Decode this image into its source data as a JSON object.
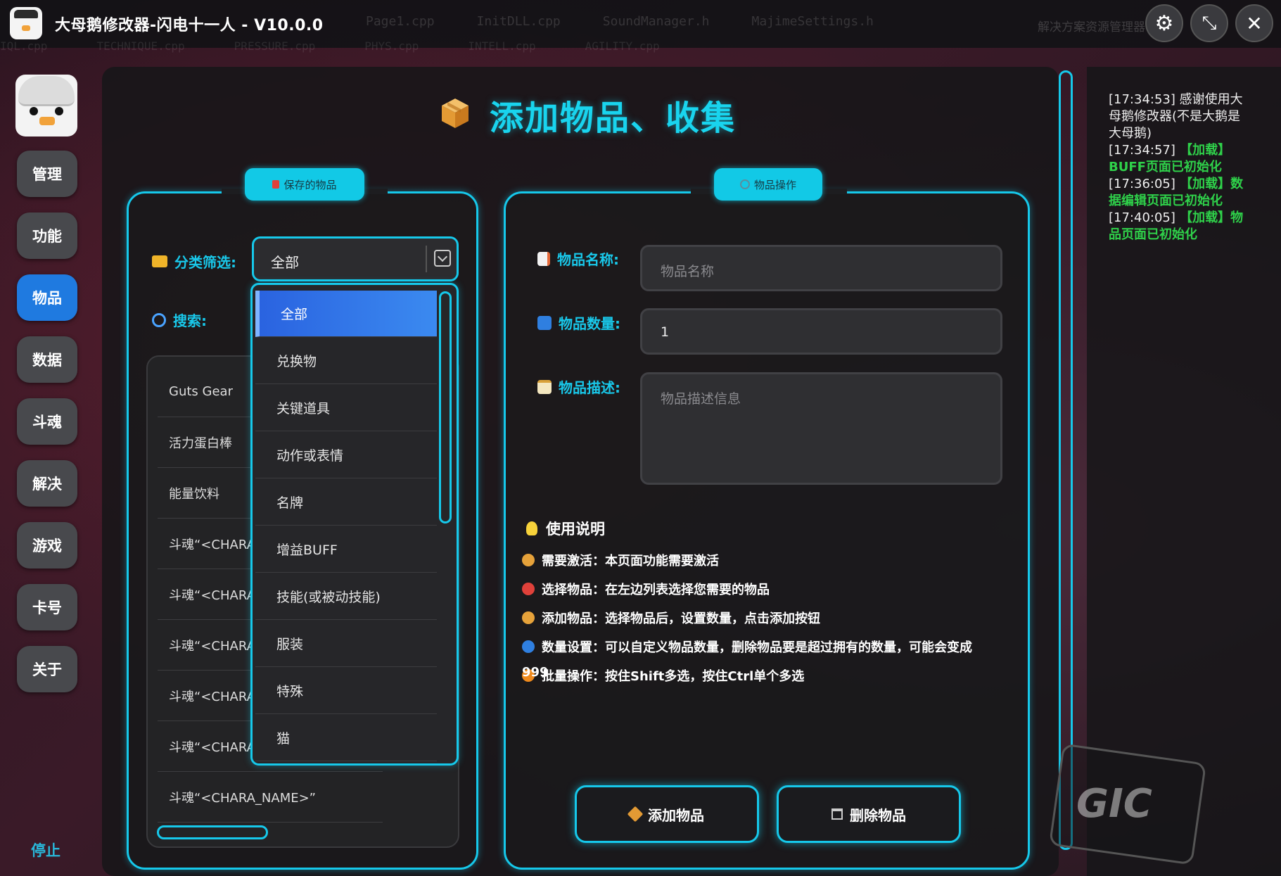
{
  "app": {
    "title": "大母鹅修改器-闪电十一人 - V10.0.0",
    "background_tabs_row1": [
      "Page1.cpp",
      "InitDLL.cpp",
      "SoundManager.h",
      "MajimeSettings.h"
    ],
    "background_tabs_row2": [
      "IQL.cpp",
      "TECHNIQUE.cpp",
      "PRESSURE.cpp",
      "PHYS.cpp",
      "INTELL.cpp",
      "AGILITY.cpp"
    ],
    "background_right_text": "解决方案资源管理器"
  },
  "window_controls": {
    "settings_icon": "gear-icon",
    "restore_icon": "shrink-arrows-icon",
    "close_icon": "close-icon",
    "close_glyph": "✕",
    "restore_glyph": "⤡",
    "settings_glyph": "⚙"
  },
  "sidebar": {
    "items": [
      {
        "label": "管理",
        "active": false
      },
      {
        "label": "功能",
        "active": false
      },
      {
        "label": "物品",
        "active": true
      },
      {
        "label": "数据",
        "active": false
      },
      {
        "label": "斗魂",
        "active": false
      },
      {
        "label": "解决",
        "active": false
      },
      {
        "label": "游戏",
        "active": false
      },
      {
        "label": "卡号",
        "active": false
      },
      {
        "label": "关于",
        "active": false
      }
    ],
    "status_label": "停止"
  },
  "page": {
    "title": "添加物品、收集"
  },
  "saved_items": {
    "group_title": "保存的物品",
    "filter_label": "分类筛选:",
    "filter_value": "全部",
    "search_label": "搜索:",
    "list": [
      "Guts Gear",
      "活力蛋白棒",
      "能量饮料",
      "斗魂“<CHARA",
      "斗魂“<CHARA",
      "斗魂“<CHARA",
      "斗魂“<CHARA",
      "斗魂“<CHARA",
      "斗魂“<CHARA_NAME>”"
    ],
    "dropdown_options": [
      "全部",
      "兑换物",
      "关键道具",
      "动作或表情",
      "名牌",
      "增益BUFF",
      "技能(或被动技能)",
      "服装",
      "特殊",
      "猫"
    ],
    "dropdown_selected": "全部"
  },
  "item_ops": {
    "group_title": "物品操作",
    "name_label": "物品名称:",
    "name_placeholder": "物品名称",
    "qty_label": "物品数量:",
    "qty_value": "1",
    "desc_label": "物品描述:",
    "desc_placeholder": "物品描述信息",
    "help_title": "使用说明",
    "help_lines": [
      {
        "text": "需要激活：本页面功能需要激活",
        "icon": "money-bag-icon",
        "color": "#e6a23a"
      },
      {
        "text": "选择物品：在左边列表选择您需要的物品",
        "icon": "target-icon",
        "color": "#e0413a"
      },
      {
        "text": "添加物品：选择物品后，设置数量，点击添加按钮",
        "icon": "package-icon",
        "color": "#e6a23a"
      },
      {
        "text": "数量设置：可以自定义物品数量，删除物品要是超过拥有的数量，可能会变成",
        "icon": "numbers-icon",
        "color": "#2f7fe0"
      },
      {
        "text": "批量操作：按住Shift多选，按住Ctrl单个多选",
        "icon": "lightning-icon",
        "color": "#f08a1c"
      }
    ],
    "help_continuation": "999",
    "add_button": "添加物品",
    "delete_button": "删除物品"
  },
  "log": [
    {
      "time": "[17:34:53]",
      "text": " 感谢使用大母鹅修改器(不是大鹅是大母鹅)",
      "highlight": ""
    },
    {
      "time": "[17:34:57]",
      "text": "",
      "highlight": " 【加载】BUFF页面已初始化"
    },
    {
      "time": "[17:36:05]",
      "text": "",
      "highlight": " 【加载】数据编辑页面已初始化"
    },
    {
      "time": "[17:40:05]",
      "text": "",
      "highlight": " 【加载】物品页面已初始化"
    }
  ],
  "decor_text": "GIC",
  "colors": {
    "accent": "#16c8ea",
    "active": "#1f7ae0",
    "log_green": "#2fd14a"
  }
}
